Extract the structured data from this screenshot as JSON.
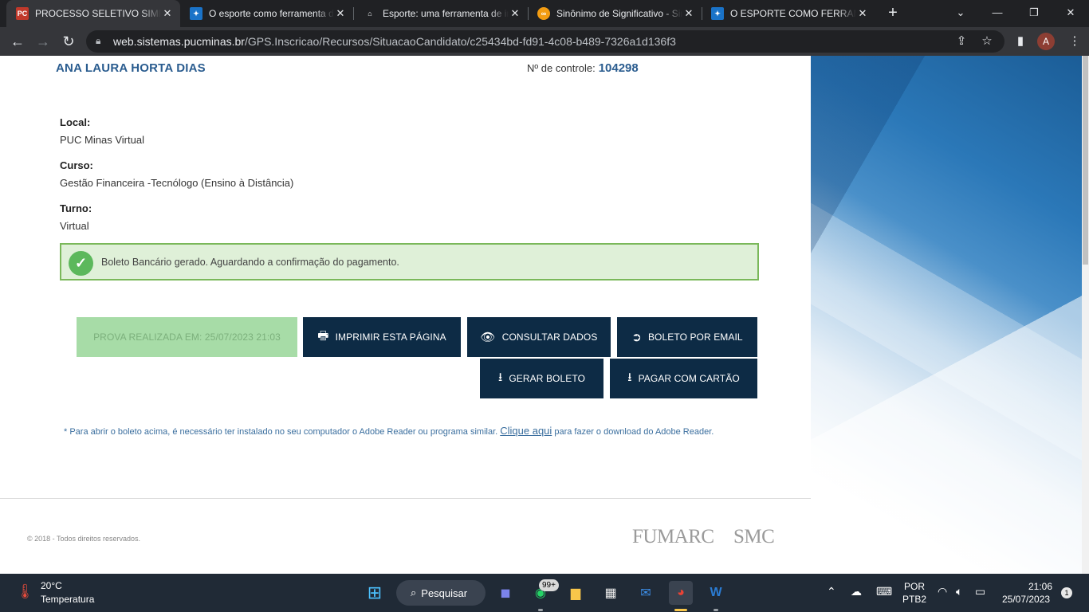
{
  "browser": {
    "tabs": [
      {
        "title": "PROCESSO SELETIVO SIMPLIFICADO",
        "favicon": "pc-favicon",
        "active": true
      },
      {
        "title": "O esporte como ferramenta de",
        "favicon": "pucminas-favicon",
        "active": false
      },
      {
        "title": "Esporte: uma ferramenta de inclusão",
        "favicon": "bridge-favicon",
        "active": false
      },
      {
        "title": "Sinônimo de Significativo - Sinônimos",
        "favicon": "sinonimos-favicon",
        "active": false
      },
      {
        "title": "O ESPORTE COMO FERRAMENTA",
        "favicon": "pucminas-favicon",
        "active": false
      }
    ],
    "url_domain": "web.sistemas.pucminas.br",
    "url_path": "/GPS.Inscricao/Recursos/SituacaoCandidato/c25434bd-fd91-4c08-b489-7326a1d136f3",
    "profile_initial": "A"
  },
  "candidate": {
    "name": "ANA LAURA HORTA DIAS",
    "control_label": "Nº de controle:",
    "control_number": "104298"
  },
  "fields": [
    {
      "label": "Local:",
      "value": "PUC Minas Virtual"
    },
    {
      "label": "Curso:",
      "value": "Gestão Financeira -Tecnólogo (Ensino à Distância)"
    },
    {
      "label": "Turno:",
      "value": "Virtual"
    }
  ],
  "alert": {
    "message": "Boleto Bancário gerado. Aguardando a confirmação do pagamento."
  },
  "buttons": {
    "prova": "PROVA REALIZADA EM: 25/07/2023 21:03",
    "imprimir": "IMPRIMIR ESTA PÁGINA",
    "consultar": "CONSULTAR DADOS",
    "boleto_email": "BOLETO POR EMAIL",
    "gerar_boleto": "GERAR BOLETO",
    "pagar_cartao": "PAGAR COM CARTÃO"
  },
  "note": {
    "text_before": "* Para abrir o boleto acima, é necessário ter instalado no seu computador o Adobe Reader ou programa similar. ",
    "link": "Clique aqui",
    "text_after": " para fazer o download do Adobe Reader."
  },
  "footer": {
    "copyright": "© 2018 - Todos direitos reservados.",
    "logo1": "FUMARC",
    "logo2": "SMC"
  },
  "taskbar": {
    "temperature": "20°C",
    "weather_label": "Temperatura",
    "search_label": "Pesquisar",
    "whatsapp_badge": "99+",
    "language": "POR",
    "layout": "PTB2",
    "time": "21:06",
    "date": "25/07/2023",
    "notifications": "1"
  },
  "colors": {
    "accent": "#0d2b45",
    "success_bg": "#dff0d8",
    "success_border": "#7ab85a",
    "name_blue": "#2a5c8f"
  }
}
